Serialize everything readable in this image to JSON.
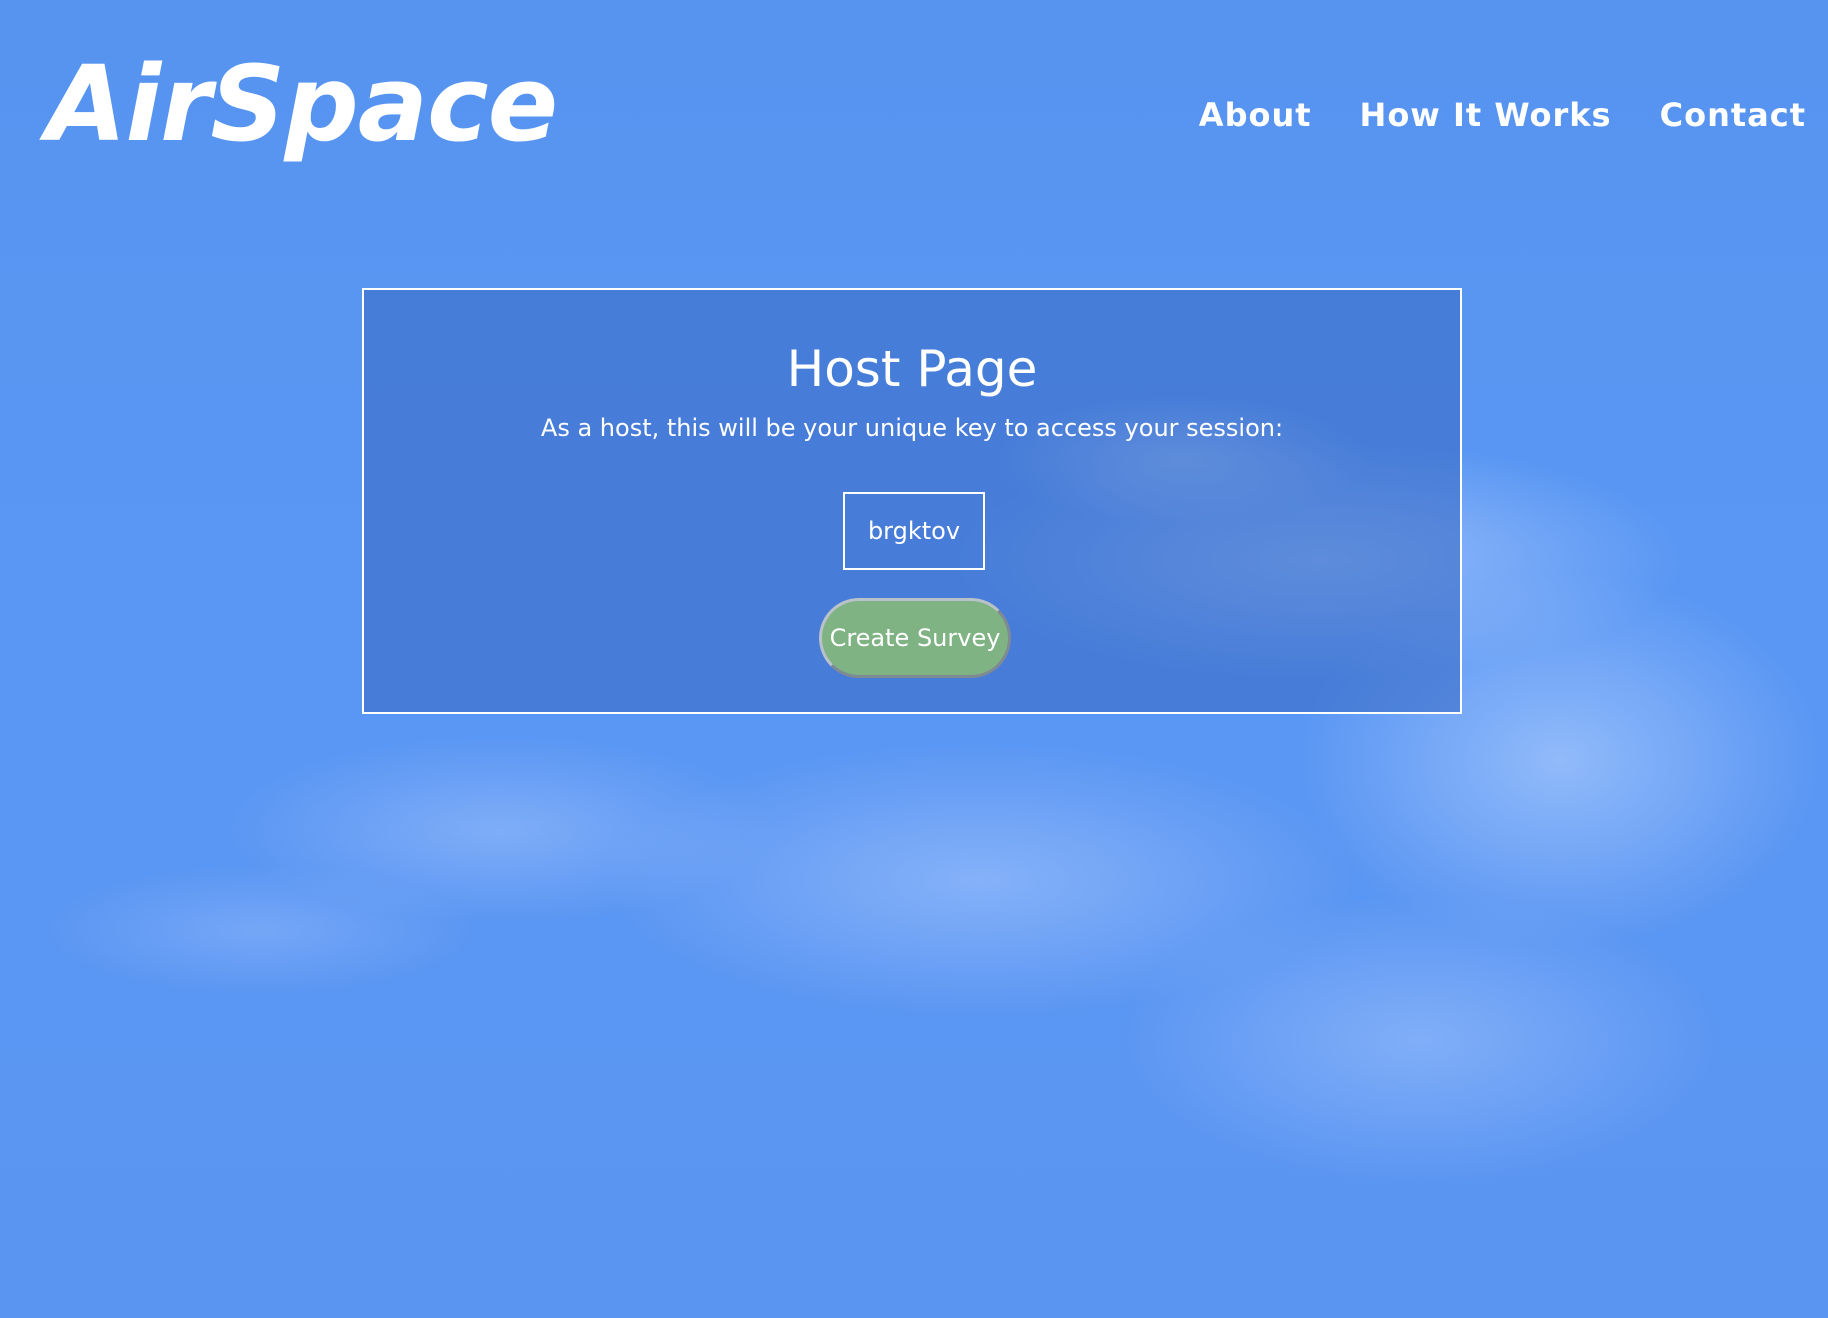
{
  "header": {
    "logo_text": "AirSpace",
    "nav": {
      "about": "About",
      "how_it_works": "How It Works",
      "contact": "Contact"
    }
  },
  "panel": {
    "title": "Host Page",
    "subtitle": "As a host, this will be your unique key to access your session:",
    "session_key": "brgktov",
    "create_survey_label": "Create Survey"
  },
  "colors": {
    "sky_blue": "#5694f0",
    "panel_bg": "#3c6ec8",
    "button_green": "#7fb384"
  }
}
